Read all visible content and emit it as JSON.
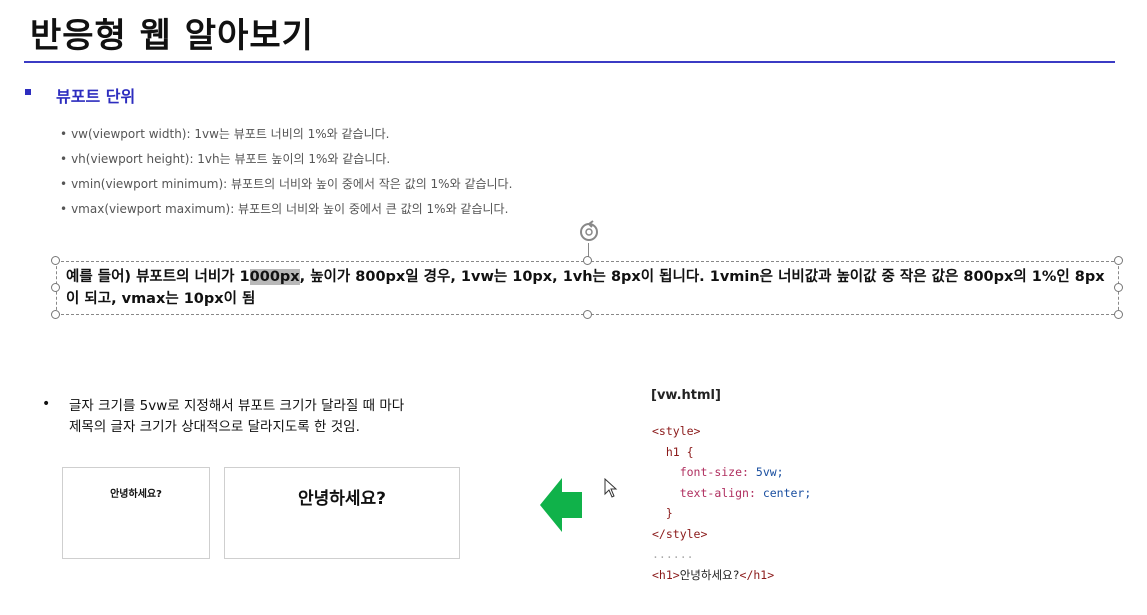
{
  "slide": {
    "title": "반응형 웹 알아보기",
    "section": "뷰포트 단위",
    "units": [
      "vw(viewport width): 1vw는 뷰포트 너비의 1%와 같습니다.",
      "vh(viewport height): 1vh는 뷰포트 높이의 1%와 같습니다.",
      "vmin(viewport minimum): 뷰포트의 너비와 높이 중에서 작은 값의 1%와 같습니다.",
      "vmax(viewport maximum): 뷰포트의 너비와 높이 중에서 큰 값의 1%와 같습니다."
    ],
    "example": {
      "before": "예를 들어) 뷰포트의 너비가 1",
      "highlight": "000px",
      "after": ", 높이가 800px일 경우, 1vw는 10px, 1vh는 8px이 됩니다. 1vmin은 너비값과 높이값 중 작은 값은 800px의 1%인 8px이 되고, vmax는 10px이 됨"
    },
    "point": {
      "bullet": "•",
      "line1": "글자 크기를 5vw로 지정해서 뷰포트 크기가 달라질 때 마다",
      "line2": "제목의 글자 크기가 상대적으로 달라지도록 한 것임."
    },
    "demo": {
      "small_heading": "안녕하세요?",
      "large_heading": "안녕하세요?"
    },
    "code": {
      "file": "[vw.html]",
      "style_open": "<style>",
      "selector": "h1 {",
      "prop1_name": "font-size:",
      "prop1_value": "5vw;",
      "prop2_name": "text-align:",
      "prop2_value": "center;",
      "close_brace": "}",
      "style_close": "</style>",
      "ellipsis": "......",
      "h1_open": "<h1>",
      "h1_text": "안녕하세요?",
      "h1_close": "</h1>"
    },
    "colors": {
      "accent": "#2d2dbf",
      "arrow": "#10b24a"
    }
  }
}
